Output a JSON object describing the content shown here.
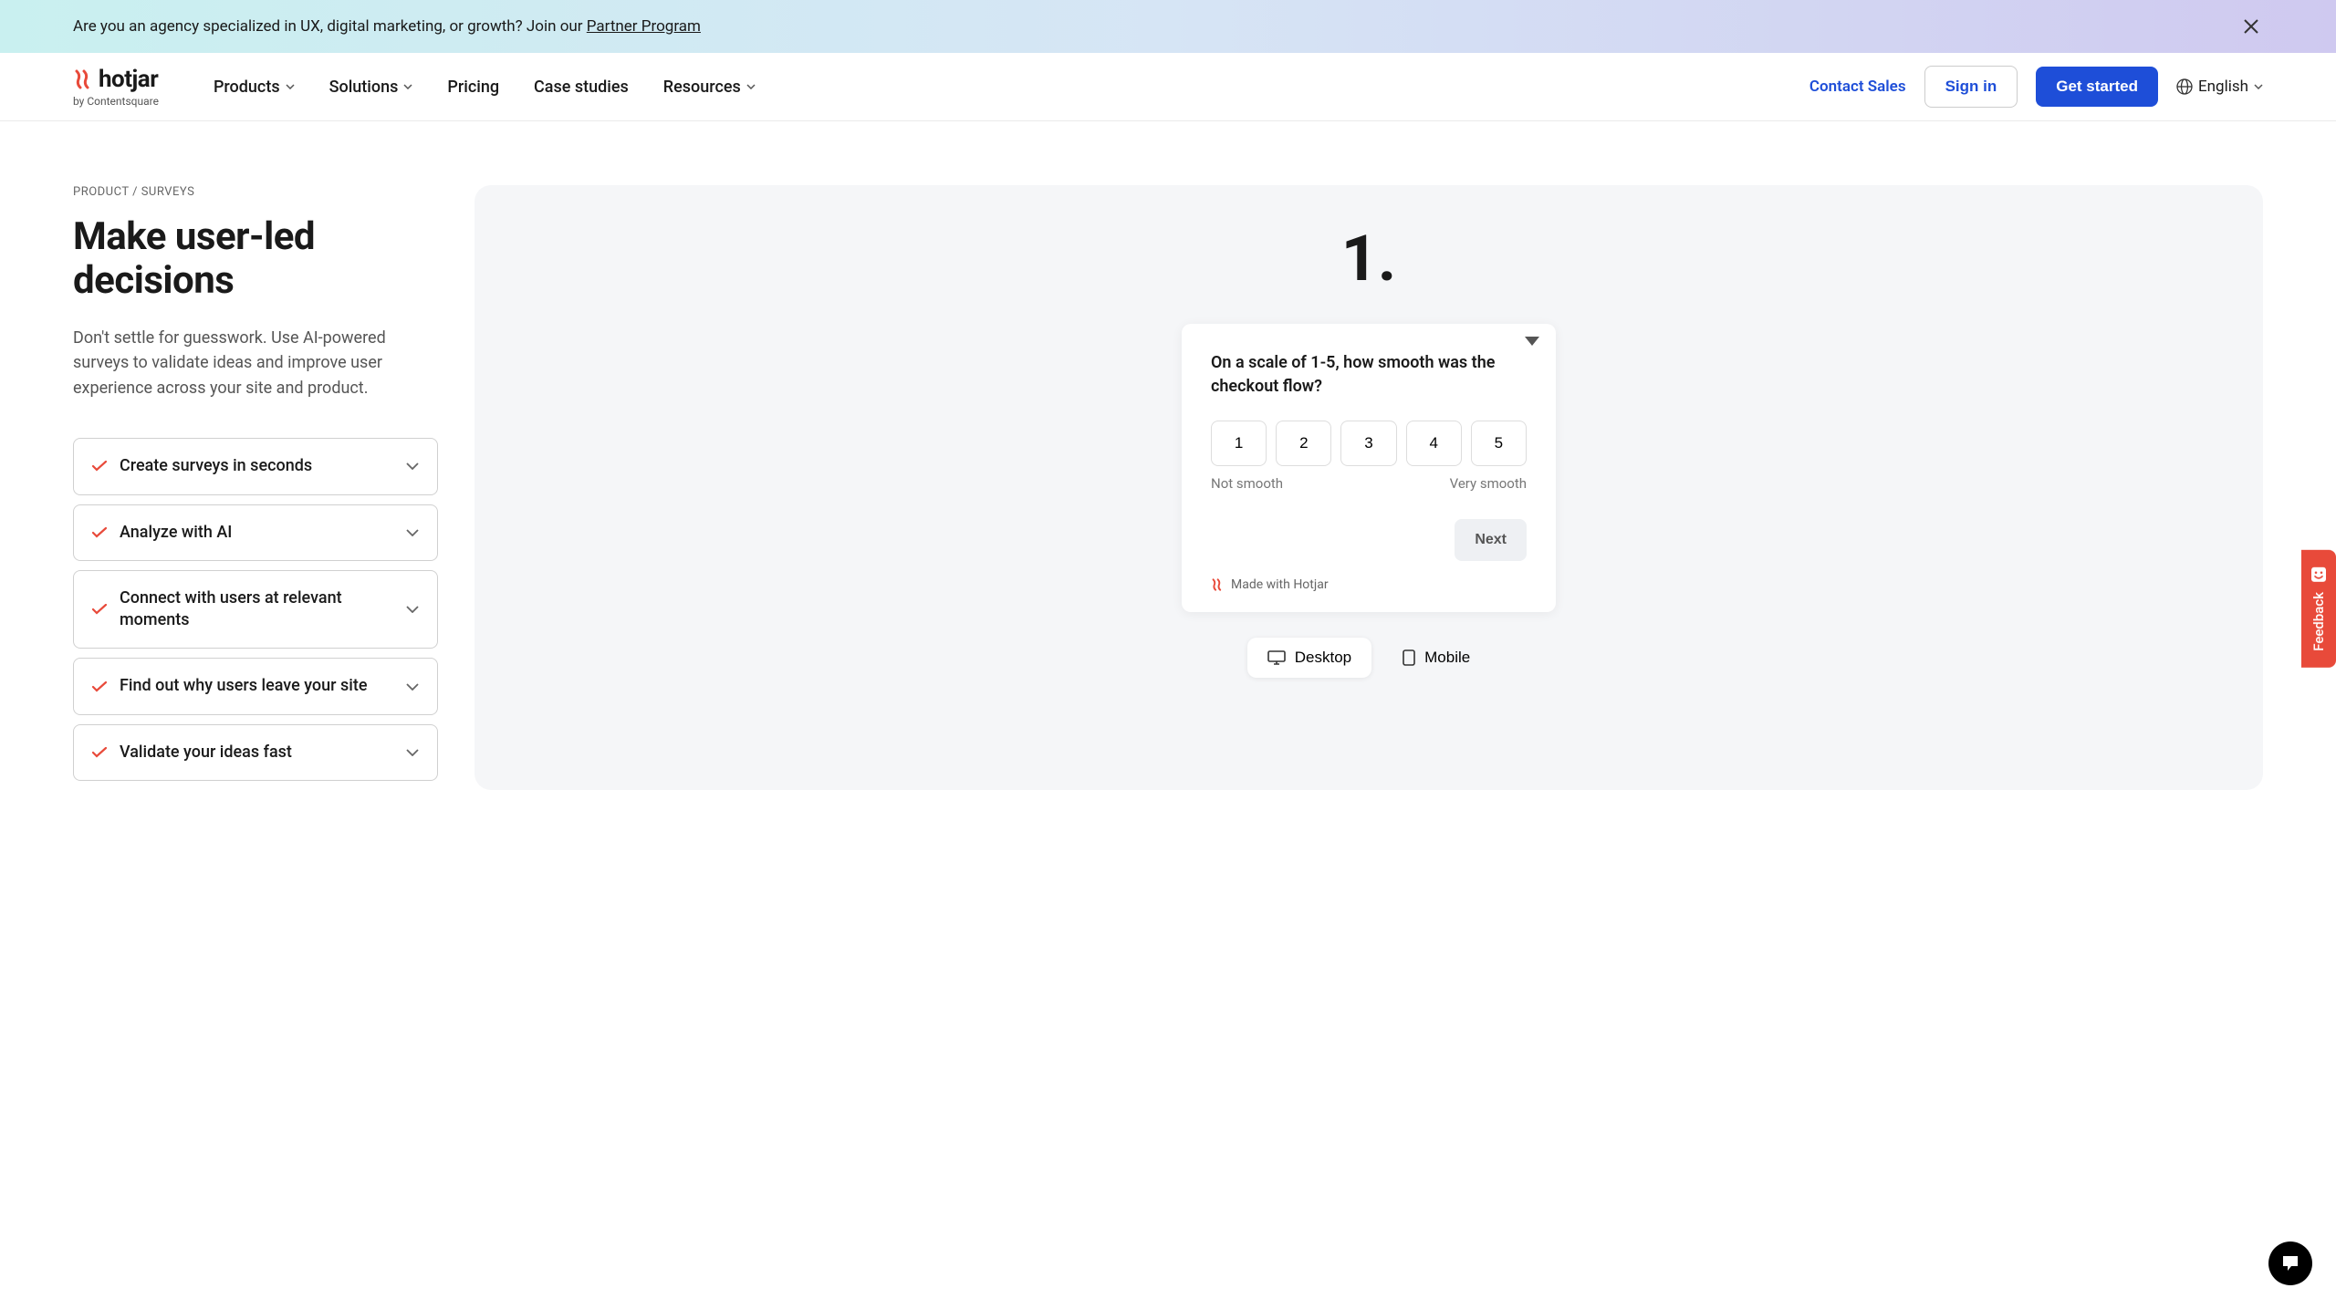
{
  "announcement": {
    "text_prefix": "Are you an agency specialized in UX, digital marketing, or growth? Join our ",
    "link_text": "Partner Program"
  },
  "logo": {
    "name": "hotjar",
    "byline": "by Contentsquare"
  },
  "nav": {
    "items": [
      {
        "label": "Products",
        "has_dropdown": true
      },
      {
        "label": "Solutions",
        "has_dropdown": true
      },
      {
        "label": "Pricing",
        "has_dropdown": false
      },
      {
        "label": "Case studies",
        "has_dropdown": false
      },
      {
        "label": "Resources",
        "has_dropdown": true
      }
    ],
    "contact": "Contact Sales",
    "signin": "Sign in",
    "cta": "Get started",
    "lang": "English"
  },
  "breadcrumb": "PRODUCT / SURVEYS",
  "page_title": "Make user-led decisions",
  "page_desc": "Don't settle for guesswork. Use AI-powered surveys to validate ideas and improve user experience across your site and product.",
  "accordion": [
    {
      "label": "Create surveys in seconds"
    },
    {
      "label": "Analyze with AI"
    },
    {
      "label": "Connect with users at relevant moments"
    },
    {
      "label": "Find out why users leave your site"
    },
    {
      "label": "Validate your ideas fast"
    }
  ],
  "preview": {
    "step": "1.",
    "question": "On a scale of 1-5, how smooth was the checkout flow?",
    "ratings": [
      "1",
      "2",
      "3",
      "4",
      "5"
    ],
    "low_label": "Not smooth",
    "high_label": "Very smooth",
    "next": "Next",
    "made_with": "Made with Hotjar",
    "devices": {
      "desktop": "Desktop",
      "mobile": "Mobile"
    }
  },
  "feedback_label": "Feedback"
}
